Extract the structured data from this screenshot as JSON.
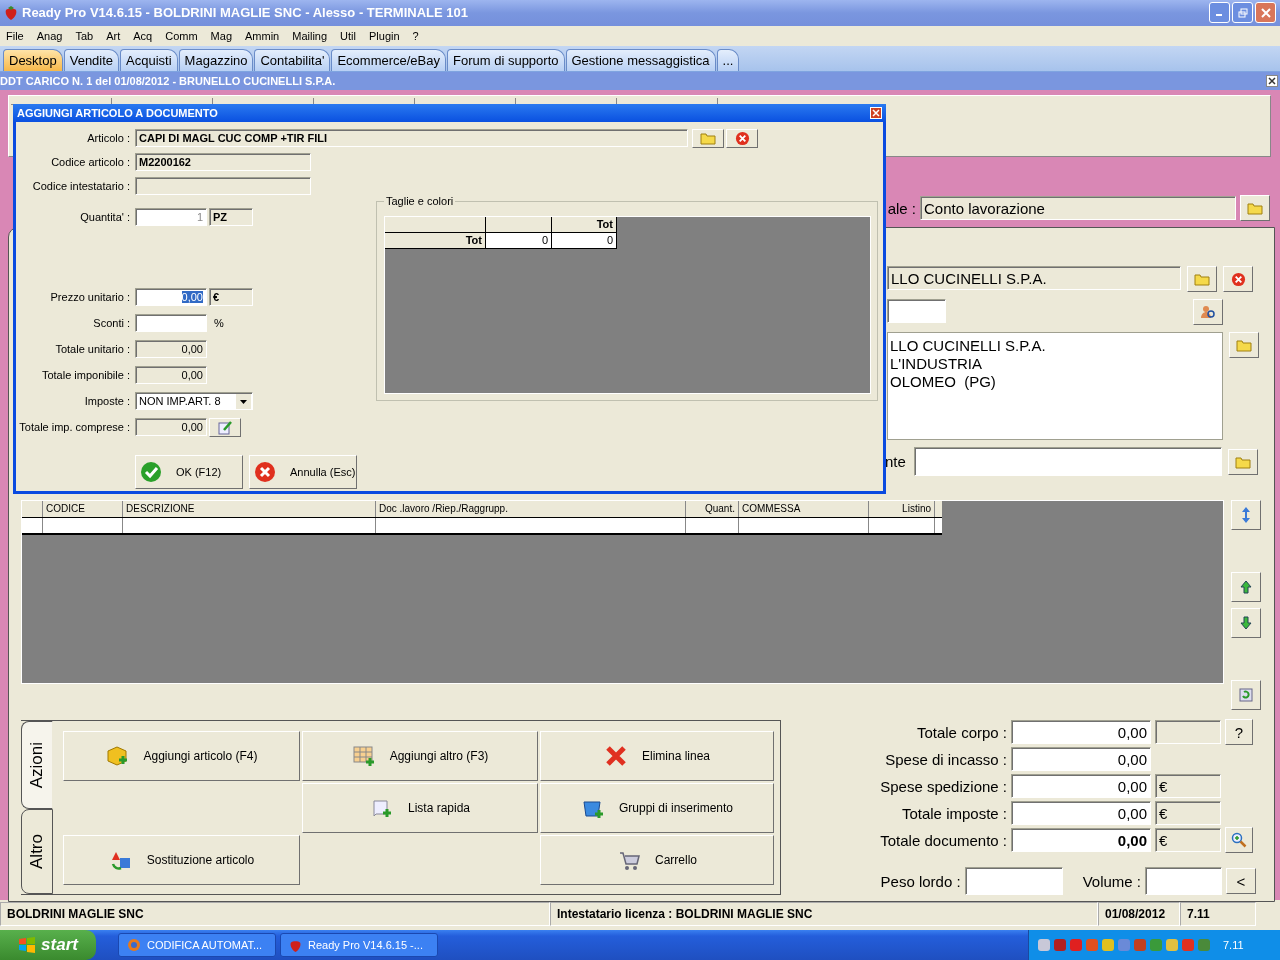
{
  "window": {
    "title": "Ready Pro V14.6.15 - BOLDRINI MAGLIE SNC - Alesso - TERMINALE 101"
  },
  "menu": [
    "File",
    "Anag",
    "Tab",
    "Art",
    "Acq",
    "Comm",
    "Mag",
    "Ammin",
    "Mailing",
    "Util",
    "Plugin",
    "?"
  ],
  "tabs": [
    {
      "label": "Desktop",
      "selected": true
    },
    {
      "label": "Vendite",
      "selected": false
    },
    {
      "label": "Acquisti",
      "selected": false
    },
    {
      "label": "Magazzino",
      "selected": false
    },
    {
      "label": "Contabilita'",
      "selected": false
    },
    {
      "label": "Ecommerce/eBay",
      "selected": false
    },
    {
      "label": "Forum di supporto",
      "selected": false
    },
    {
      "label": "Gestione messaggistica",
      "selected": false
    },
    {
      "label": "...",
      "selected": false
    }
  ],
  "document": {
    "title": "DDT CARICO N. 1  del 01/08/2012 - BRUNELLO CUCINELLI S.P.A.",
    "causale": {
      "label": "ale :",
      "value": "Conto lavorazione"
    },
    "supplier": {
      "name": "LLO CUCINELLI S.P.A.",
      "address": [
        "LLO CUCINELLI S.P.A.",
        "L'INDUSTRIA",
        "OLOMEO  (PG)"
      ]
    },
    "destination_label": "nte",
    "lines_columns": [
      "CODICE",
      "DESCRIZIONE",
      "Doc .lavoro /Riep./Raggrupp.",
      "Quant.",
      "COMMESSA",
      "Listino"
    ],
    "action_tabs": [
      {
        "label": "Azioni",
        "selected": true
      },
      {
        "label": "Altro",
        "selected": false
      }
    ],
    "actions": [
      "Aggiungi articolo (F4)",
      "Aggiungi altro (F3)",
      "Elimina linea",
      "Lista rapida",
      "Gruppi di inserimento",
      "Sostituzione articolo",
      "Carrello"
    ],
    "totals": [
      {
        "label": "Totale corpo :",
        "value": "0,00",
        "unit_box": true,
        "bold": false,
        "button": "?",
        "zoom_button": false
      },
      {
        "label": "Spese di incasso :",
        "value": "0,00",
        "unit_box": false,
        "bold": false,
        "zoom_button": false
      },
      {
        "label": "Spese spedizione :",
        "value": "0,00",
        "unit_box": true,
        "unit": "€",
        "bold": false,
        "zoom_button": false
      },
      {
        "label": "Totale imposte :",
        "value": "0,00",
        "unit_box": true,
        "unit": "€",
        "bold": false,
        "zoom_button": false
      },
      {
        "label": "Totale documento :",
        "value": "0,00",
        "unit_box": true,
        "unit": "€",
        "bold": true,
        "zoom_button": true
      }
    ],
    "weight_label": "Peso lordo :",
    "volume_label": "Volume :",
    "collapse_button": "<"
  },
  "dialog": {
    "title": "AGGIUNGI ARTICOLO A DOCUMENTO",
    "articolo": {
      "label": "Articolo :",
      "value": "CAPI DI MAGL CUC COMP +TIR FILI"
    },
    "codice": {
      "label": "Codice articolo :",
      "value": "M2200162"
    },
    "intestatario": {
      "label": "Codice intestatario :"
    },
    "quantita": {
      "label": "Quantita' :",
      "value": "1",
      "unit": "PZ"
    },
    "prezzo": {
      "label": "Prezzo unitario :",
      "value": "0,00",
      "unit": "€",
      "focused": true
    },
    "sconti": {
      "label": "Sconti :",
      "unit": "%"
    },
    "totale_unitario": {
      "label": "Totale unitario :",
      "value": "0,00"
    },
    "totale_imponibile": {
      "label": "Totale imponibile :",
      "value": "0,00"
    },
    "imposte": {
      "label": "Imposte :",
      "value": "NON IMP.ART. 8"
    },
    "totale_comprese": {
      "label": "Totale imp. comprese :",
      "value": "0,00"
    },
    "sizes": {
      "title": "Taglie e colori",
      "header": "Tot",
      "rows": [
        {
          "label": "Tot",
          "values": [
            "0",
            "0"
          ]
        }
      ]
    },
    "buttons": [
      {
        "label": "OK (F12)",
        "kind": "confirm"
      },
      {
        "label": "Annulla (Esc)",
        "kind": "cancel"
      }
    ]
  },
  "status_bar": [
    "BOLDRINI MAGLIE SNC",
    "Intestatario licenza : BOLDRINI MAGLIE SNC",
    "01/08/2012",
    "7.11"
  ],
  "taskbar": {
    "start": "start",
    "tasks": [
      "CODIFICA AUTOMAT...",
      "Ready Pro V14.6.15 -..."
    ],
    "clock": "7.11"
  }
}
